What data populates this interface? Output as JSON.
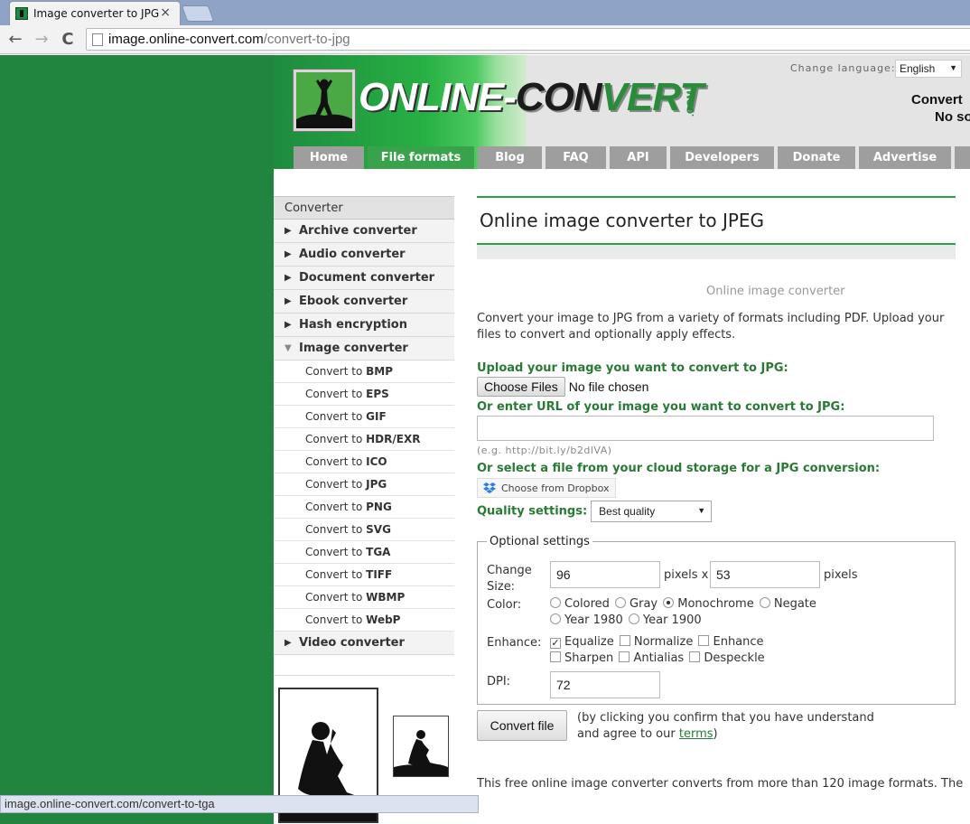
{
  "browser": {
    "tab_title": "Image converter to JPG",
    "tab_close": "×",
    "url_domain": "image.online-convert.com",
    "url_path": "/convert-to-jpg",
    "back": "←",
    "forward": "→",
    "reload": "C"
  },
  "header": {
    "logo_part1": "ONLINE-",
    "logo_part2": "CON",
    "logo_part3": "VERT",
    "logo_com": ".COM",
    "change_language_label": "Change language:",
    "language_value": "English",
    "right_line1": "Convert",
    "right_line2": "No so"
  },
  "nav": [
    {
      "label": "Home"
    },
    {
      "label": "File formats"
    },
    {
      "label": "Blog"
    },
    {
      "label": "FAQ"
    },
    {
      "label": "API"
    },
    {
      "label": "Developers"
    },
    {
      "label": "Donate"
    },
    {
      "label": "Advertise"
    }
  ],
  "sidebar": {
    "heading": "Converter",
    "items_top": [
      {
        "label": "Archive converter",
        "arrow": "▶"
      },
      {
        "label": "Audio converter",
        "arrow": "▶"
      },
      {
        "label": "Document converter",
        "arrow": "▶"
      },
      {
        "label": "Ebook converter",
        "arrow": "▶"
      },
      {
        "label": "Hash encryption",
        "arrow": "▶"
      },
      {
        "label": "Image converter",
        "arrow": "▼"
      }
    ],
    "sub_prefix": "Convert to",
    "sub_items": [
      "BMP",
      "EPS",
      "GIF",
      "HDR/EXR",
      "ICO",
      "JPG",
      "PNG",
      "SVG",
      "TGA",
      "TIFF",
      "WBMP",
      "WebP"
    ],
    "items_bottom": [
      {
        "label": "Video converter",
        "arrow": "▶"
      }
    ]
  },
  "main": {
    "title": "Online image converter to JPEG",
    "ad_label": "Online image converter",
    "description": "Convert your image to JPG from a variety of formats including PDF. Upload your files to convert and optionally apply effects.",
    "upload_label": "Upload your image you want to convert to JPG:",
    "choose_files": "Choose Files",
    "no_file": "No file chosen",
    "url_label": "Or enter URL of your image you want to convert to JPG:",
    "url_hint": "(e.g. http://bit.ly/b2dlVA)",
    "cloud_label": "Or select a file from your cloud storage for a JPG conversion:",
    "dropbox_btn": "Choose from Dropbox",
    "quality_label": "Quality settings:",
    "quality_value": "Best quality",
    "optional": {
      "legend": "Optional settings",
      "change_size_label": "Change Size:",
      "width_value": "96",
      "pixels_x": "pixels x",
      "height_value": "53",
      "pixels": "pixels",
      "color_label": "Color:",
      "color_options": [
        "Colored",
        "Gray",
        "Monochrome",
        "Negate",
        "Year 1980",
        "Year 1900"
      ],
      "color_selected": "Monochrome",
      "enhance_label": "Enhance:",
      "enhance_options": [
        "Equalize",
        "Normalize",
        "Enhance",
        "Sharpen",
        "Antialias",
        "Despeckle"
      ],
      "enhance_checked": [
        "Equalize"
      ],
      "dpi_label": "DPI:",
      "dpi_value": "72"
    },
    "convert_button": "Convert file",
    "confirm_text_before": "(by clicking you confirm that you have understand and agree to our ",
    "terms_link": "terms",
    "confirm_text_after": ")",
    "bottom_text": "This free online image converter converts from more than 120 image formats. The"
  },
  "status_bar": "image.online-convert.com/convert-to-tga"
}
